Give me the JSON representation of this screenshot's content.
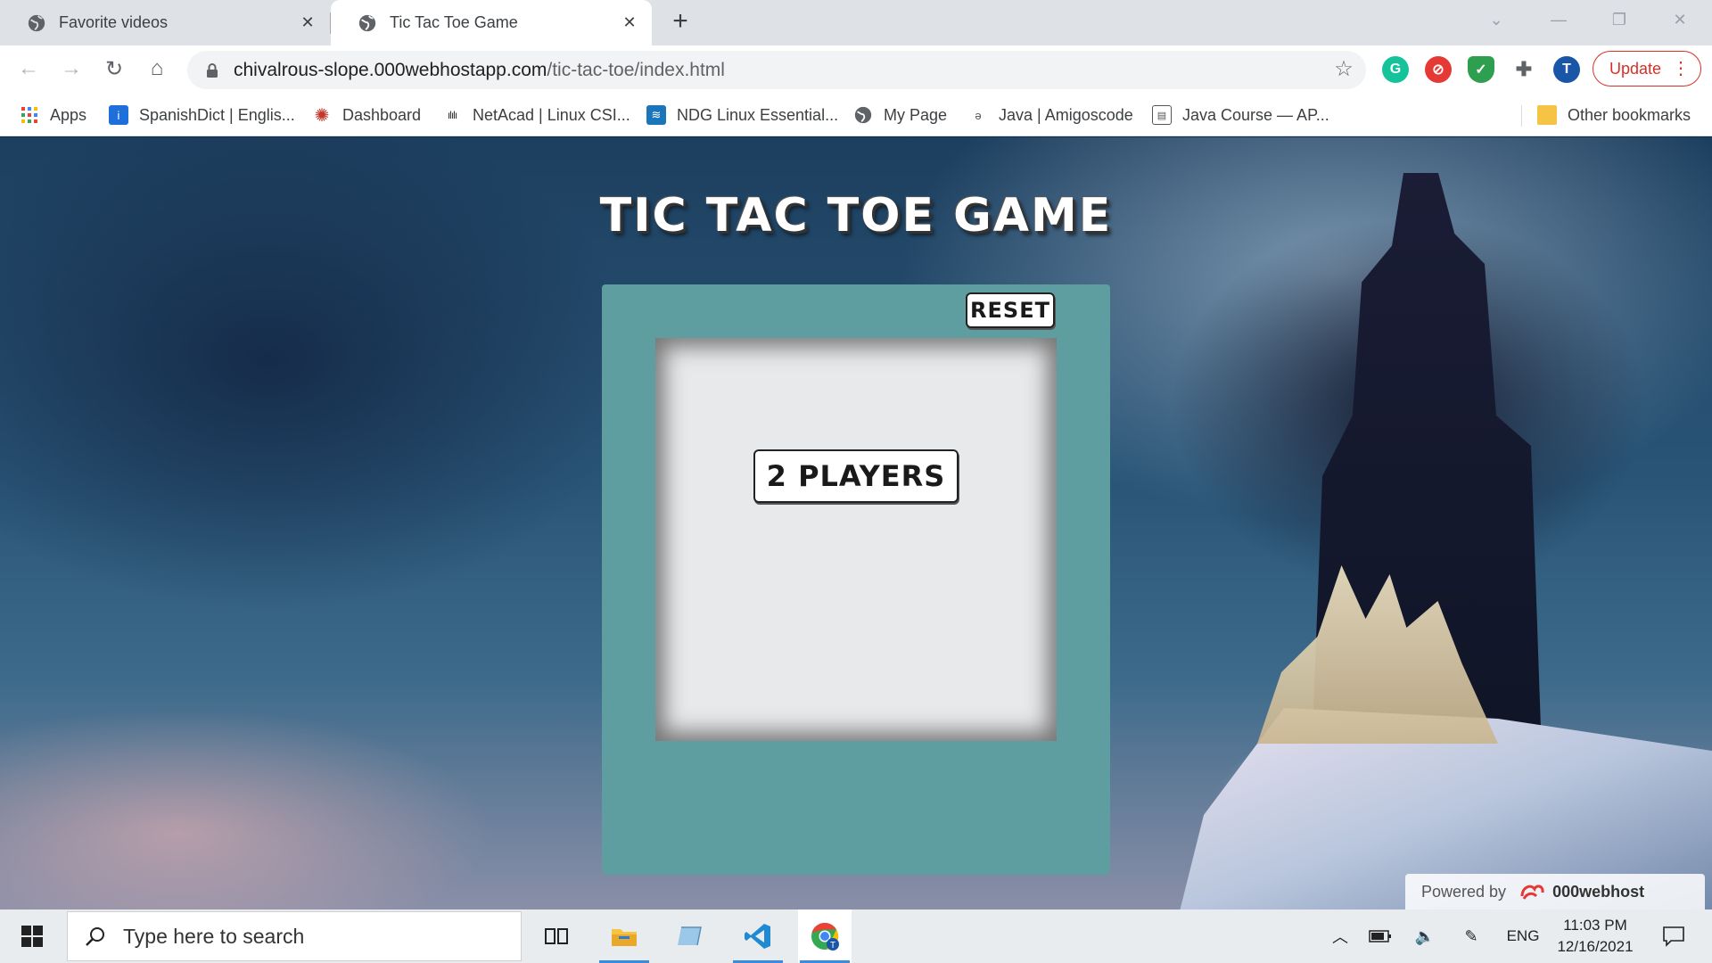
{
  "browser": {
    "tabs": [
      {
        "label": "Favorite videos",
        "active": false
      },
      {
        "label": "Tic Tac Toe Game",
        "active": true
      }
    ],
    "new_tab": "+",
    "url_host": "chivalrous-slope.000webhostapp.com",
    "url_path": "/tic-tac-toe/index.html",
    "update_label": "Update",
    "profile_initial": "T",
    "bookmarks": [
      {
        "label": "Apps"
      },
      {
        "label": "SpanishDict | Englis..."
      },
      {
        "label": "Dashboard"
      },
      {
        "label": "NetAcad | Linux CSI..."
      },
      {
        "label": "NDG Linux Essential..."
      },
      {
        "label": "My Page"
      },
      {
        "label": "Java | Amigoscode"
      },
      {
        "label": "Java Course — AP..."
      }
    ],
    "other_bookmarks": "Other bookmarks"
  },
  "page": {
    "title": "TIC TAC TOE GAME",
    "reset_label": "RESET",
    "players_label": "2 PLAYERS",
    "powered_by": "Powered by",
    "host_brand": "000webhost"
  },
  "taskbar": {
    "search_placeholder": "Type here to search",
    "language": "ENG",
    "time": "11:03 PM",
    "date": "12/16/2021"
  },
  "colors": {
    "panel": "#5f9ea0",
    "board": "#e8e9eb",
    "update_accent": "#d93025"
  }
}
